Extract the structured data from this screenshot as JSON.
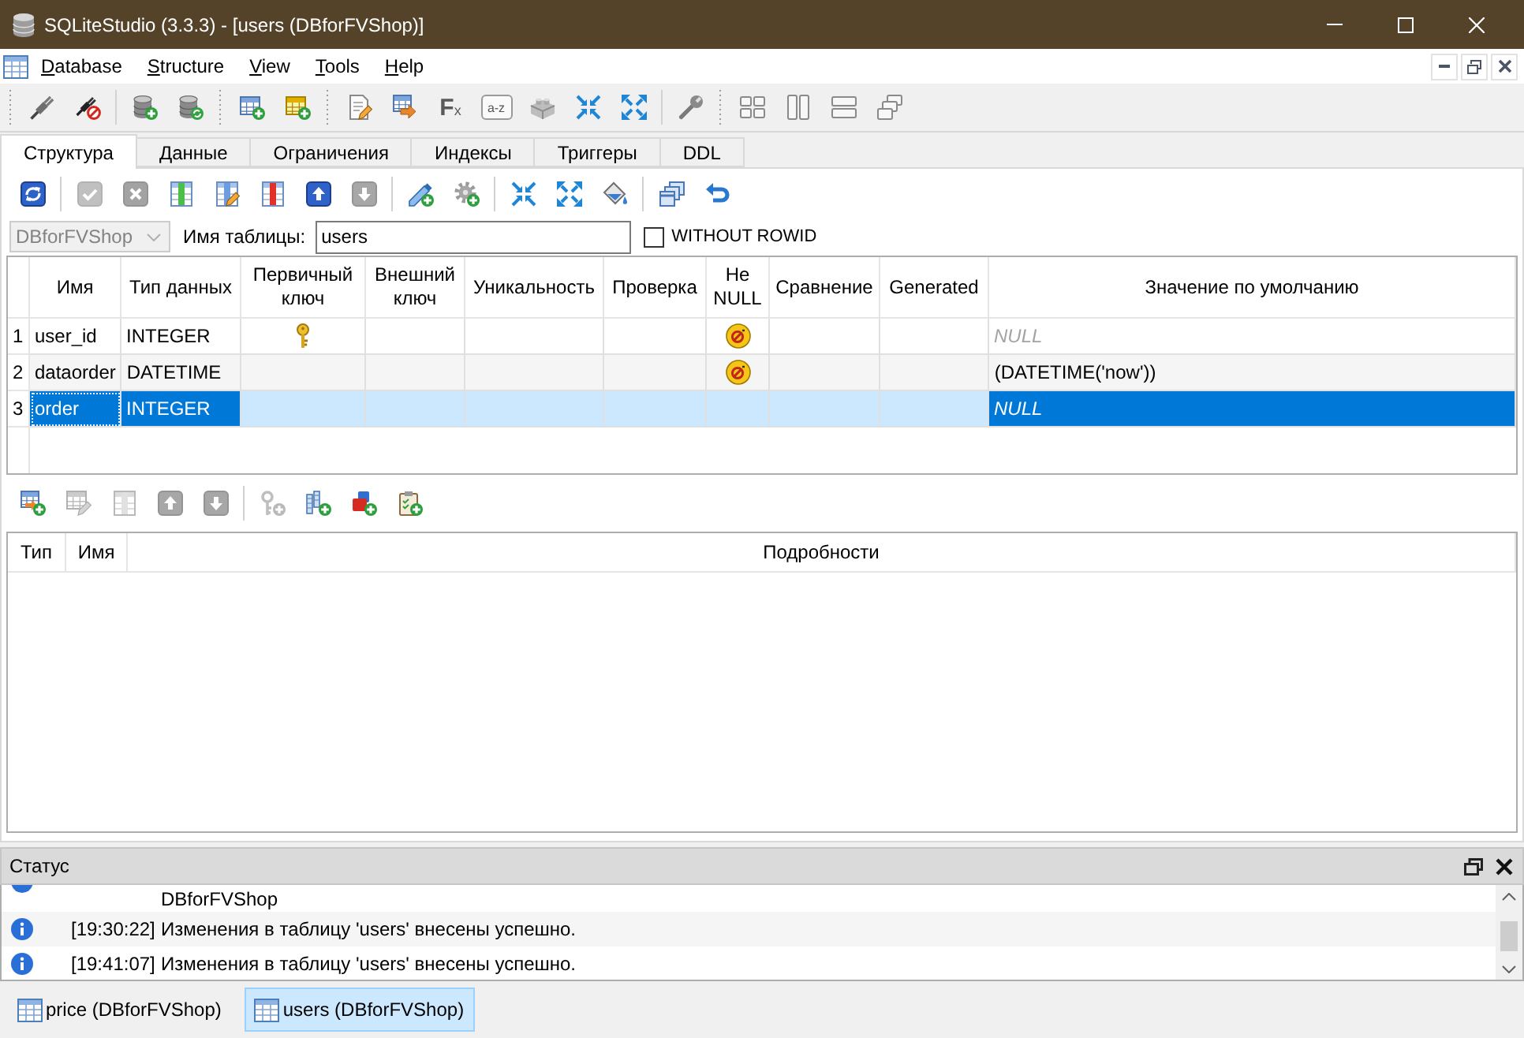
{
  "window": {
    "title": "SQLiteStudio (3.3.3) - [users (DBforFVShop)]"
  },
  "menu": [
    "Database",
    "Structure",
    "View",
    "Tools",
    "Help"
  ],
  "main_toolbar": [
    {
      "kind": "grip"
    },
    {
      "kind": "icon"
    },
    {
      "kind": "icon"
    },
    {
      "kind": "separator"
    },
    {
      "kind": "icon"
    },
    {
      "kind": "icon"
    },
    {
      "kind": "grip"
    },
    {
      "kind": "icon"
    },
    {
      "kind": "icon"
    },
    {
      "kind": "grip"
    },
    {
      "kind": "icon"
    },
    {
      "kind": "icon"
    },
    {
      "kind": "text",
      "text": "F$_{x}$"
    },
    {
      "kind": "bubble",
      "text": "a-z"
    },
    {
      "kind": "icon"
    },
    {
      "kind": "icon"
    },
    {
      "kind": "icon"
    },
    {
      "kind": "separator"
    },
    {
      "kind": "icon"
    },
    {
      "kind": "grip"
    },
    {
      "kind": "icon"
    },
    {
      "kind": "icon"
    },
    {
      "kind": "icon"
    },
    {
      "kind": "icon"
    }
  ],
  "tabs": [
    {
      "label": "Структура",
      "selected": true
    },
    {
      "label": "Данные",
      "selected": false
    },
    {
      "label": "Ограничения",
      "selected": false
    },
    {
      "label": "Индексы",
      "selected": false
    },
    {
      "label": "Триггеры",
      "selected": false
    },
    {
      "label": "DDL",
      "selected": false
    }
  ],
  "structure_toolbar": [
    {
      "kind": "icon",
      "disabled": false
    },
    {
      "kind": "separator"
    },
    {
      "kind": "icon",
      "disabled": true
    },
    {
      "kind": "icon",
      "disabled": true
    },
    {
      "kind": "icon",
      "disabled": false
    },
    {
      "kind": "icon",
      "disabled": false
    },
    {
      "kind": "icon",
      "disabled": false
    },
    {
      "kind": "icon",
      "disabled": false
    },
    {
      "kind": "icon",
      "disabled": true
    },
    {
      "kind": "separator"
    },
    {
      "kind": "icon",
      "disabled": false
    },
    {
      "kind": "icon",
      "disabled": false
    },
    {
      "kind": "separator"
    },
    {
      "kind": "icon",
      "disabled": false
    },
    {
      "kind": "icon",
      "disabled": false
    },
    {
      "kind": "icon",
      "disabled": false
    },
    {
      "kind": "separator"
    },
    {
      "kind": "icon",
      "disabled": false
    },
    {
      "kind": "icon",
      "disabled": false
    }
  ],
  "table_header": {
    "database": {
      "value": "DBforFVShop",
      "disabled": true
    },
    "name_label": "Имя таблицы:",
    "name_value": "users",
    "without_rowid": {
      "label": "WITHOUT ROWID",
      "checked": false
    }
  },
  "columns_table": {
    "headers": [
      "Имя",
      "Тип данных",
      "Первичный ключ",
      "Внешний ключ",
      "Уникальность",
      "Проверка",
      "Не NULL",
      "Сравнение",
      "Generated",
      "Значение по умолчанию"
    ],
    "rows": [
      {
        "number": "1",
        "name": "user_id",
        "type": "INTEGER",
        "primary_key": true,
        "not_null": true,
        "default": "NULL",
        "default_is_null": true,
        "selected": false,
        "focused": false
      },
      {
        "number": "2",
        "name": "dataorder",
        "type": "DATETIME",
        "primary_key": false,
        "not_null": true,
        "default": "(DATETIME('now'))",
        "default_is_null": false,
        "selected": false,
        "focused": false
      },
      {
        "number": "3",
        "name": "order",
        "type": "INTEGER",
        "primary_key": false,
        "not_null": false,
        "default": "NULL",
        "default_is_null": true,
        "selected": true,
        "focused": true
      }
    ]
  },
  "constraints_toolbar": [
    {
      "kind": "icon",
      "disabled": false
    },
    {
      "kind": "icon",
      "disabled": true
    },
    {
      "kind": "icon",
      "disabled": true
    },
    {
      "kind": "icon",
      "disabled": true
    },
    {
      "kind": "icon",
      "disabled": true
    },
    {
      "kind": "separator"
    },
    {
      "kind": "icon",
      "disabled": true
    },
    {
      "kind": "icon",
      "disabled": false
    },
    {
      "kind": "icon",
      "disabled": false
    },
    {
      "kind": "icon",
      "disabled": false
    }
  ],
  "constraints_table": {
    "headers": [
      "Тип",
      "Имя",
      "Подробности"
    ]
  },
  "status": {
    "title": "Статус",
    "entries": [
      {
        "kind": "clipped",
        "message": "DBforFVShop"
      },
      {
        "kind": "info",
        "time": "[19:30:22]",
        "message": "Изменения в таблицу 'users' внесены успешно."
      },
      {
        "kind": "info",
        "time": "[19:41:07]",
        "message": "Изменения в таблицу 'users' внесены успешно."
      }
    ]
  },
  "window_tabs": [
    {
      "label": "price (DBforFVShop)",
      "selected": false
    },
    {
      "label": "users (DBforFVShop)",
      "selected": true
    }
  ]
}
